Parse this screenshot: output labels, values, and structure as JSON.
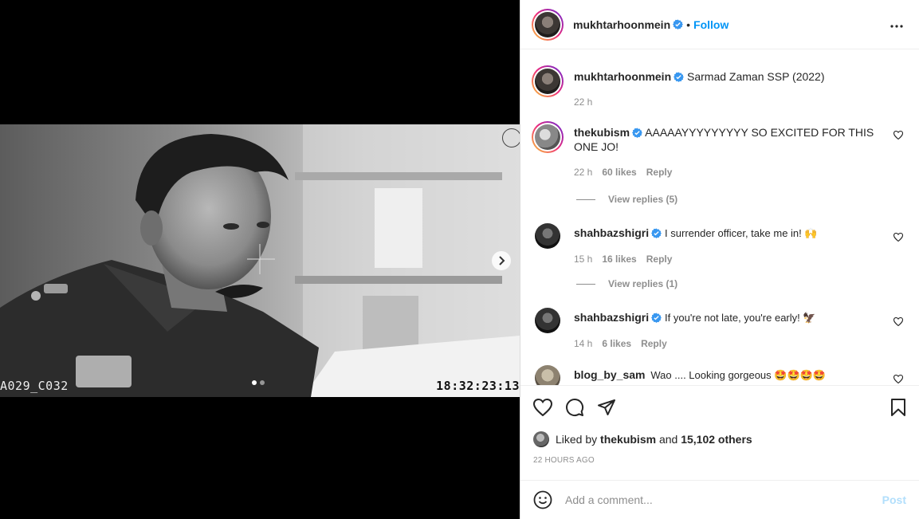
{
  "post": {
    "author": "mukhtarhoonmein",
    "follow_label": "Follow",
    "dot": "•",
    "caption": "Sarmad Zaman SSP (2022)",
    "caption_time": "22 h"
  },
  "media": {
    "timecode_left": "A029_C032",
    "timecode_right": "18:32:23:13",
    "slide_count": 2,
    "active_slide": 1
  },
  "comments": [
    {
      "user": "thekubism",
      "text": "AAAAAYYYYYYYYY SO EXCITED FOR THIS ONE JO!",
      "time": "22 h",
      "likes": "60 likes",
      "reply_label": "Reply",
      "view_replies": "View replies (5)"
    },
    {
      "user": "shahbazshigri",
      "text": "I surrender officer, take me in! 🙌",
      "time": "15 h",
      "likes": "16 likes",
      "reply_label": "Reply",
      "view_replies": "View replies (1)"
    },
    {
      "user": "shahbazshigri",
      "text": "If you're not late, you're early! 🦅",
      "time": "14 h",
      "likes": "6 likes",
      "reply_label": "Reply"
    },
    {
      "user": "blog_by_sam",
      "text": "Wao .... Looking gorgeous 🤩🤩🤩🤩"
    }
  ],
  "likes": {
    "prefix": "Liked by",
    "user": "thekubism",
    "and": "and",
    "others": "15,102 others"
  },
  "date": "22 HOURS AGO",
  "add_comment": {
    "placeholder": "Add a comment...",
    "post_label": "Post"
  },
  "colors": {
    "accent": "#0095f6",
    "verified": "#3897f0",
    "muted": "#8e8e8e",
    "post_disabled": "#b2dffc"
  },
  "icons": [
    "verified-badge-icon",
    "more-options-icon",
    "heart-icon",
    "comment-icon",
    "share-icon",
    "bookmark-icon",
    "emoji-icon",
    "chevron-right-icon"
  ]
}
